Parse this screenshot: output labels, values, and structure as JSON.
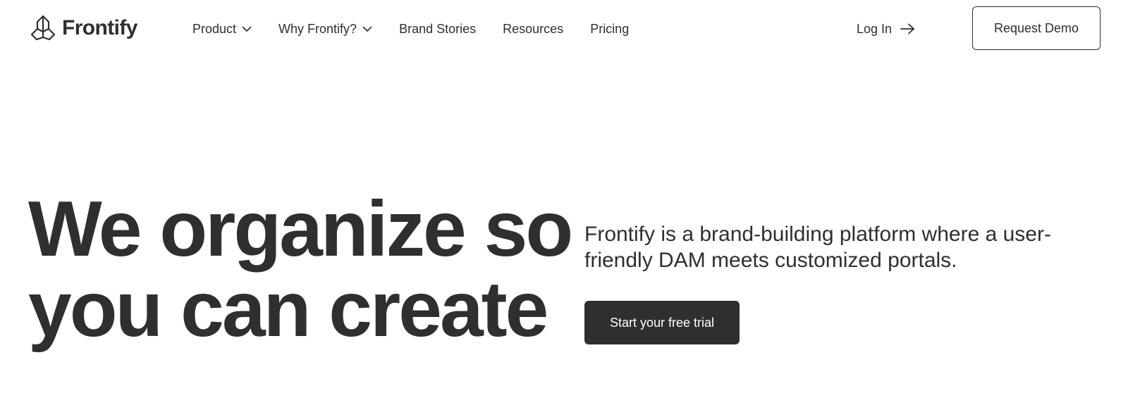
{
  "header": {
    "logo": {
      "icon": "frontify-logo-icon",
      "text": "Frontify"
    },
    "nav": [
      {
        "label": "Product",
        "has_dropdown": true
      },
      {
        "label": "Why Frontify?",
        "has_dropdown": true
      },
      {
        "label": "Brand Stories",
        "has_dropdown": false
      },
      {
        "label": "Resources",
        "has_dropdown": false
      },
      {
        "label": "Pricing",
        "has_dropdown": false
      }
    ],
    "login": {
      "label": "Log In",
      "icon": "arrow-right-icon"
    },
    "demo_button": "Request Demo"
  },
  "hero": {
    "headline_line1": "We organize so",
    "headline_line2": "you can create",
    "description": "Frontify is a brand-building platform where a user-friendly DAM meets customized portals.",
    "cta": "Start your free trial"
  },
  "colors": {
    "text": "#2d2f31",
    "background": "#ffffff",
    "cta_background": "#2d2f31",
    "cta_text": "#ffffff"
  }
}
